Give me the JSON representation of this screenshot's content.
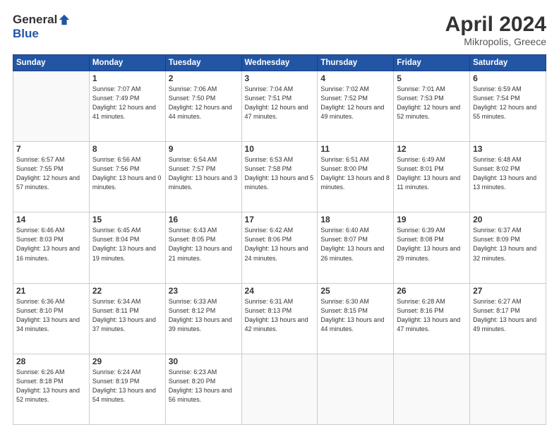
{
  "logo": {
    "general": "General",
    "blue": "Blue"
  },
  "title": "April 2024",
  "location": "Mikropolis, Greece",
  "days_header": [
    "Sunday",
    "Monday",
    "Tuesday",
    "Wednesday",
    "Thursday",
    "Friday",
    "Saturday"
  ],
  "weeks": [
    [
      {
        "day": "",
        "sunrise": "",
        "sunset": "",
        "daylight": ""
      },
      {
        "day": "1",
        "sunrise": "Sunrise: 7:07 AM",
        "sunset": "Sunset: 7:49 PM",
        "daylight": "Daylight: 12 hours and 41 minutes."
      },
      {
        "day": "2",
        "sunrise": "Sunrise: 7:06 AM",
        "sunset": "Sunset: 7:50 PM",
        "daylight": "Daylight: 12 hours and 44 minutes."
      },
      {
        "day": "3",
        "sunrise": "Sunrise: 7:04 AM",
        "sunset": "Sunset: 7:51 PM",
        "daylight": "Daylight: 12 hours and 47 minutes."
      },
      {
        "day": "4",
        "sunrise": "Sunrise: 7:02 AM",
        "sunset": "Sunset: 7:52 PM",
        "daylight": "Daylight: 12 hours and 49 minutes."
      },
      {
        "day": "5",
        "sunrise": "Sunrise: 7:01 AM",
        "sunset": "Sunset: 7:53 PM",
        "daylight": "Daylight: 12 hours and 52 minutes."
      },
      {
        "day": "6",
        "sunrise": "Sunrise: 6:59 AM",
        "sunset": "Sunset: 7:54 PM",
        "daylight": "Daylight: 12 hours and 55 minutes."
      }
    ],
    [
      {
        "day": "7",
        "sunrise": "Sunrise: 6:57 AM",
        "sunset": "Sunset: 7:55 PM",
        "daylight": "Daylight: 12 hours and 57 minutes."
      },
      {
        "day": "8",
        "sunrise": "Sunrise: 6:56 AM",
        "sunset": "Sunset: 7:56 PM",
        "daylight": "Daylight: 13 hours and 0 minutes."
      },
      {
        "day": "9",
        "sunrise": "Sunrise: 6:54 AM",
        "sunset": "Sunset: 7:57 PM",
        "daylight": "Daylight: 13 hours and 3 minutes."
      },
      {
        "day": "10",
        "sunrise": "Sunrise: 6:53 AM",
        "sunset": "Sunset: 7:58 PM",
        "daylight": "Daylight: 13 hours and 5 minutes."
      },
      {
        "day": "11",
        "sunrise": "Sunrise: 6:51 AM",
        "sunset": "Sunset: 8:00 PM",
        "daylight": "Daylight: 13 hours and 8 minutes."
      },
      {
        "day": "12",
        "sunrise": "Sunrise: 6:49 AM",
        "sunset": "Sunset: 8:01 PM",
        "daylight": "Daylight: 13 hours and 11 minutes."
      },
      {
        "day": "13",
        "sunrise": "Sunrise: 6:48 AM",
        "sunset": "Sunset: 8:02 PM",
        "daylight": "Daylight: 13 hours and 13 minutes."
      }
    ],
    [
      {
        "day": "14",
        "sunrise": "Sunrise: 6:46 AM",
        "sunset": "Sunset: 8:03 PM",
        "daylight": "Daylight: 13 hours and 16 minutes."
      },
      {
        "day": "15",
        "sunrise": "Sunrise: 6:45 AM",
        "sunset": "Sunset: 8:04 PM",
        "daylight": "Daylight: 13 hours and 19 minutes."
      },
      {
        "day": "16",
        "sunrise": "Sunrise: 6:43 AM",
        "sunset": "Sunset: 8:05 PM",
        "daylight": "Daylight: 13 hours and 21 minutes."
      },
      {
        "day": "17",
        "sunrise": "Sunrise: 6:42 AM",
        "sunset": "Sunset: 8:06 PM",
        "daylight": "Daylight: 13 hours and 24 minutes."
      },
      {
        "day": "18",
        "sunrise": "Sunrise: 6:40 AM",
        "sunset": "Sunset: 8:07 PM",
        "daylight": "Daylight: 13 hours and 26 minutes."
      },
      {
        "day": "19",
        "sunrise": "Sunrise: 6:39 AM",
        "sunset": "Sunset: 8:08 PM",
        "daylight": "Daylight: 13 hours and 29 minutes."
      },
      {
        "day": "20",
        "sunrise": "Sunrise: 6:37 AM",
        "sunset": "Sunset: 8:09 PM",
        "daylight": "Daylight: 13 hours and 32 minutes."
      }
    ],
    [
      {
        "day": "21",
        "sunrise": "Sunrise: 6:36 AM",
        "sunset": "Sunset: 8:10 PM",
        "daylight": "Daylight: 13 hours and 34 minutes."
      },
      {
        "day": "22",
        "sunrise": "Sunrise: 6:34 AM",
        "sunset": "Sunset: 8:11 PM",
        "daylight": "Daylight: 13 hours and 37 minutes."
      },
      {
        "day": "23",
        "sunrise": "Sunrise: 6:33 AM",
        "sunset": "Sunset: 8:12 PM",
        "daylight": "Daylight: 13 hours and 39 minutes."
      },
      {
        "day": "24",
        "sunrise": "Sunrise: 6:31 AM",
        "sunset": "Sunset: 8:13 PM",
        "daylight": "Daylight: 13 hours and 42 minutes."
      },
      {
        "day": "25",
        "sunrise": "Sunrise: 6:30 AM",
        "sunset": "Sunset: 8:15 PM",
        "daylight": "Daylight: 13 hours and 44 minutes."
      },
      {
        "day": "26",
        "sunrise": "Sunrise: 6:28 AM",
        "sunset": "Sunset: 8:16 PM",
        "daylight": "Daylight: 13 hours and 47 minutes."
      },
      {
        "day": "27",
        "sunrise": "Sunrise: 6:27 AM",
        "sunset": "Sunset: 8:17 PM",
        "daylight": "Daylight: 13 hours and 49 minutes."
      }
    ],
    [
      {
        "day": "28",
        "sunrise": "Sunrise: 6:26 AM",
        "sunset": "Sunset: 8:18 PM",
        "daylight": "Daylight: 13 hours and 52 minutes."
      },
      {
        "day": "29",
        "sunrise": "Sunrise: 6:24 AM",
        "sunset": "Sunset: 8:19 PM",
        "daylight": "Daylight: 13 hours and 54 minutes."
      },
      {
        "day": "30",
        "sunrise": "Sunrise: 6:23 AM",
        "sunset": "Sunset: 8:20 PM",
        "daylight": "Daylight: 13 hours and 56 minutes."
      },
      {
        "day": "",
        "sunrise": "",
        "sunset": "",
        "daylight": ""
      },
      {
        "day": "",
        "sunrise": "",
        "sunset": "",
        "daylight": ""
      },
      {
        "day": "",
        "sunrise": "",
        "sunset": "",
        "daylight": ""
      },
      {
        "day": "",
        "sunrise": "",
        "sunset": "",
        "daylight": ""
      }
    ]
  ]
}
